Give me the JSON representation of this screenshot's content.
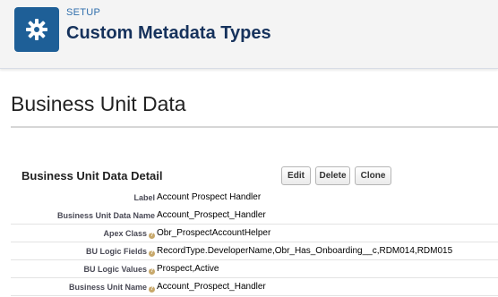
{
  "header": {
    "eyebrow": "SETUP",
    "title": "Custom Metadata Types",
    "icon": "gear-icon"
  },
  "record": {
    "title": "Business Unit Data",
    "section_title": "Business Unit Data Detail"
  },
  "buttons": {
    "edit": "Edit",
    "delete": "Delete",
    "clone": "Clone"
  },
  "fields": [
    {
      "label": "Label",
      "value": "Account Prospect Handler",
      "help": false
    },
    {
      "label": "Business Unit Data Name",
      "value": "Account_Prospect_Handler",
      "help": false
    },
    {
      "label": "Apex Class",
      "value": "Obr_ProspectAccountHelper",
      "help": true
    },
    {
      "label": "BU Logic Fields",
      "value": "RecordType.DeveloperName,Obr_Has_Onboarding__c,RDM014,RDM015",
      "help": true
    },
    {
      "label": "BU Logic Values",
      "value": "Prospect,Active",
      "help": true
    },
    {
      "label": "Business Unit Name",
      "value": "Account_Prospect_Handler",
      "help": true
    }
  ],
  "colors": {
    "icon_bg": "#1e5f97",
    "eyebrow": "#2f6eac",
    "title": "#16325c",
    "help_icon": "#c7a86b"
  }
}
